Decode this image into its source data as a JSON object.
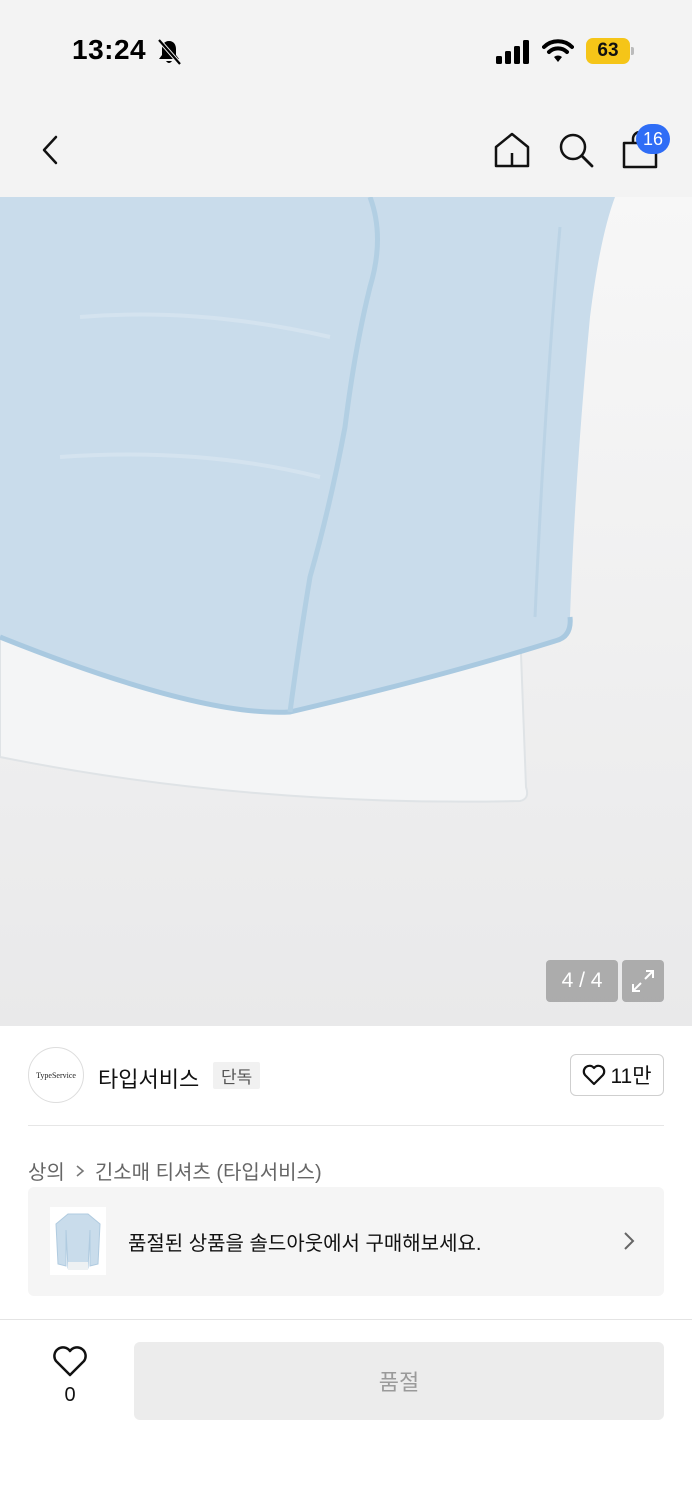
{
  "status_bar": {
    "time": "13:24",
    "battery": "63",
    "battery_color": "#f5c518",
    "icons": [
      "bell-off-icon",
      "signal-icon",
      "wifi-icon",
      "battery-icon"
    ]
  },
  "header": {
    "icons": [
      "chevron-left-icon",
      "home-icon",
      "search-icon",
      "shopping-bag-icon"
    ],
    "cart_count": "16",
    "badge_color": "#2f6df6"
  },
  "gallery": {
    "counter": "4 / 4",
    "expand_icon": "expand-icon"
  },
  "brand": {
    "logo_text": "TypeService",
    "name": "타입서비스",
    "tag": "단독",
    "like_count": "11만"
  },
  "breadcrumb": {
    "items": [
      "상의",
      "긴소매 티셔츠 (타입서비스)"
    ]
  },
  "soldout_banner": {
    "text": "품절된 상품을 솔드아웃에서 구매해보세요."
  },
  "bottom_bar": {
    "wish_count": "0",
    "buy_label": "품절"
  }
}
